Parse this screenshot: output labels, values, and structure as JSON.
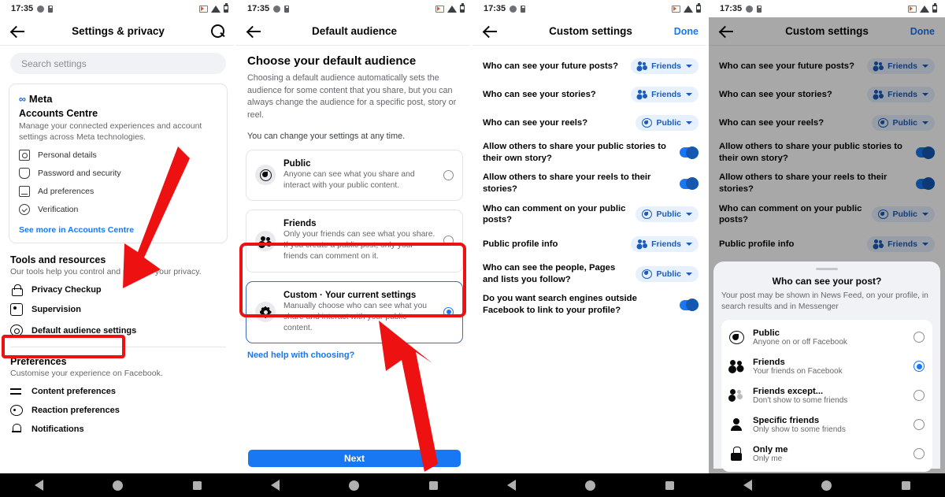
{
  "statusbar": {
    "time": "17:35"
  },
  "panel1": {
    "title": "Settings & privacy",
    "search_placeholder": "Search settings",
    "accounts_card": {
      "brand": "Meta",
      "heading": "Accounts Centre",
      "description": "Manage your connected experiences and account settings across Meta technologies.",
      "items": [
        {
          "label": "Personal details",
          "icon": "id-card-icon"
        },
        {
          "label": "Password and security",
          "icon": "shield-icon"
        },
        {
          "label": "Ad preferences",
          "icon": "ad-icon"
        },
        {
          "label": "Verification",
          "icon": "verified-badge-icon"
        }
      ],
      "link": "See more in Accounts Centre"
    },
    "tools": {
      "heading": "Tools and resources",
      "subtitle": "Our tools help you control and manage your privacy.",
      "items": [
        {
          "label": "Privacy Checkup",
          "icon": "lock-icon"
        },
        {
          "label": "Supervision",
          "icon": "supervision-icon"
        },
        {
          "label": "Default audience settings",
          "icon": "gear-icon",
          "highlighted": true
        }
      ]
    },
    "preferences": {
      "heading": "Preferences",
      "subtitle": "Customise your experience on Facebook.",
      "items": [
        {
          "label": "Content preferences",
          "icon": "sliders-icon"
        },
        {
          "label": "Reaction preferences",
          "icon": "reaction-icon"
        },
        {
          "label": "Notifications",
          "icon": "bell-icon"
        }
      ]
    }
  },
  "panel2": {
    "title": "Default audience",
    "heading": "Choose your default audience",
    "paragraph": "Choosing a default audience automatically sets the audience for some content that you share, but you can always change the audience for a specific post, story or reel.",
    "paragraph2": "You can change your settings at any time.",
    "options": [
      {
        "icon": "globe-icon",
        "title": "Public",
        "desc": "Anyone can see what you share and interact with your public content.",
        "selected": false
      },
      {
        "icon": "friends-icon",
        "title": "Friends",
        "desc": "Only your friends can see what you share. If you create a public post, only your friends can comment on it.",
        "selected": false
      },
      {
        "icon": "gear-icon",
        "title": "Custom · Your current settings",
        "desc": "Manually choose who can see what you share and interact with your public content.",
        "selected": true
      }
    ],
    "need_help": "Need help with choosing?",
    "next_label": "Next"
  },
  "panel3": {
    "title": "Custom settings",
    "done_label": "Done",
    "rows": [
      {
        "label": "Who can see your future posts?",
        "control": "chip",
        "value": "Friends",
        "icon": "friends-icon"
      },
      {
        "label": "Who can see your stories?",
        "control": "chip",
        "value": "Friends",
        "icon": "friends-icon"
      },
      {
        "label": "Who can see your reels?",
        "control": "chip",
        "value": "Public",
        "icon": "globe-icon"
      },
      {
        "label": "Allow others to share your public stories to their own story?",
        "control": "toggle",
        "value": "on"
      },
      {
        "label": "Allow others to share your reels to their stories?",
        "control": "toggle",
        "value": "on"
      },
      {
        "label": "Who can comment on your public posts?",
        "control": "chip",
        "value": "Public",
        "icon": "globe-icon"
      },
      {
        "label": "Public profile info",
        "control": "chip",
        "value": "Friends",
        "icon": "friends-icon"
      },
      {
        "label": "Who can see the people, Pages and lists you follow?",
        "control": "chip",
        "value": "Public",
        "icon": "globe-icon"
      },
      {
        "label": "Do you want search engines outside Facebook to link to your profile?",
        "control": "toggle",
        "value": "on"
      }
    ]
  },
  "panel4": {
    "title": "Custom settings",
    "done_label": "Done",
    "rows": [
      {
        "label": "Who can see your future posts?",
        "control": "chip",
        "value": "Friends",
        "icon": "friends-icon"
      },
      {
        "label": "Who can see your stories?",
        "control": "chip",
        "value": "Friends",
        "icon": "friends-icon"
      },
      {
        "label": "Who can see your reels?",
        "control": "chip",
        "value": "Public",
        "icon": "globe-icon"
      },
      {
        "label": "Allow others to share your public stories to their own story?",
        "control": "toggle",
        "value": "on"
      },
      {
        "label": "Allow others to share your reels to their stories?",
        "control": "toggle",
        "value": "on"
      },
      {
        "label": "Who can comment on your public posts?",
        "control": "chip",
        "value": "Public",
        "icon": "globe-icon"
      },
      {
        "label": "Public profile info",
        "control": "chip",
        "value": "Friends",
        "icon": "friends-icon"
      }
    ],
    "sheet": {
      "heading": "Who can see your post?",
      "subtitle": "Your post may be shown in News Feed, on your profile, in search results and in Messenger",
      "options": [
        {
          "icon": "globe-icon",
          "title": "Public",
          "desc": "Anyone on or off Facebook",
          "selected": false
        },
        {
          "icon": "friends-icon",
          "title": "Friends",
          "desc": "Your friends on Facebook",
          "selected": true
        },
        {
          "icon": "friends-except-icon",
          "title": "Friends except...",
          "desc": "Don't show to some friends",
          "selected": false
        },
        {
          "icon": "person-icon",
          "title": "Specific friends",
          "desc": "Only show to some friends",
          "selected": false
        },
        {
          "icon": "lock-icon",
          "title": "Only me",
          "desc": "Only me",
          "selected": false
        }
      ]
    }
  },
  "annotations": {
    "accent_color": "#ee1111",
    "arrow1": "points from Accounts Centre card down-left to Default audience settings",
    "arrow2": "points from below up-left to the Custom option"
  }
}
